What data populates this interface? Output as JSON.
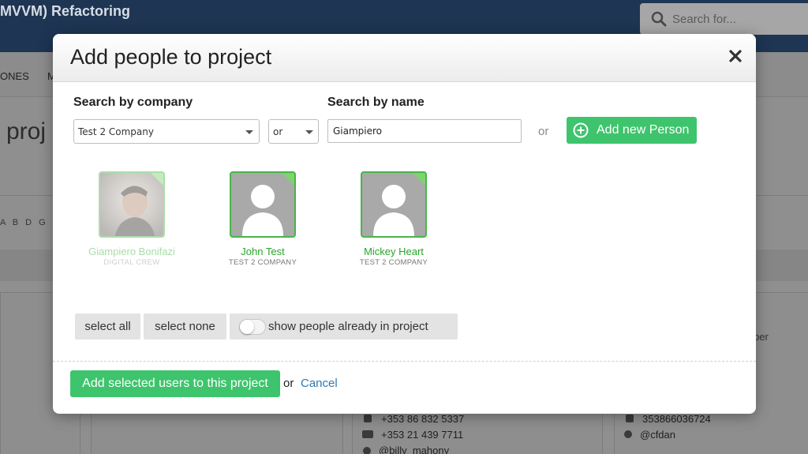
{
  "background": {
    "project_title": "MVVM) Refactoring",
    "search_placeholder": "Search for...",
    "nav_item_1": "ONES",
    "nav_item_2": "M",
    "heading": "proj",
    "alphabet": "A B D G J",
    "card3": {
      "phone": "+353 86 832 5337",
      "fax": "+353 21 439 7711",
      "twitter": "@billy_mahony"
    },
    "card4": {
      "phone": "353866036724",
      "twitter": "@cfdan",
      "role_fragment": "ber"
    }
  },
  "modal": {
    "title": "Add people to project",
    "search_company_label": "Search by company",
    "search_name_label": "Search by name",
    "company_selected": "Test 2 Company",
    "operator_selected": "or",
    "name_value": "Giampiero",
    "or_text": "or",
    "add_person_label": "Add new Person",
    "people": [
      {
        "name": "Giampiero Bonifazi",
        "company": "DIGITAL CREW",
        "dimmed": true
      },
      {
        "name": "John Test",
        "company": "TEST 2 COMPANY",
        "dimmed": false
      },
      {
        "name": "Mickey Heart",
        "company": "TEST 2 COMPANY",
        "dimmed": false
      }
    ],
    "select_all_label": "select all",
    "select_none_label": "select none",
    "show_people_label": "show people already in project",
    "show_people_on": false,
    "submit_label": "Add selected users to this project",
    "or_label": "or",
    "cancel_label": "Cancel"
  },
  "colors": {
    "primary_green": "#3ec46d",
    "link_blue": "#2d78b4",
    "header_navy": "#1e3553"
  },
  "icons": [
    "search-icon",
    "close-icon",
    "plus-circle-icon",
    "user-silhouette-icon",
    "phone-icon",
    "fax-icon",
    "twitter-icon"
  ]
}
